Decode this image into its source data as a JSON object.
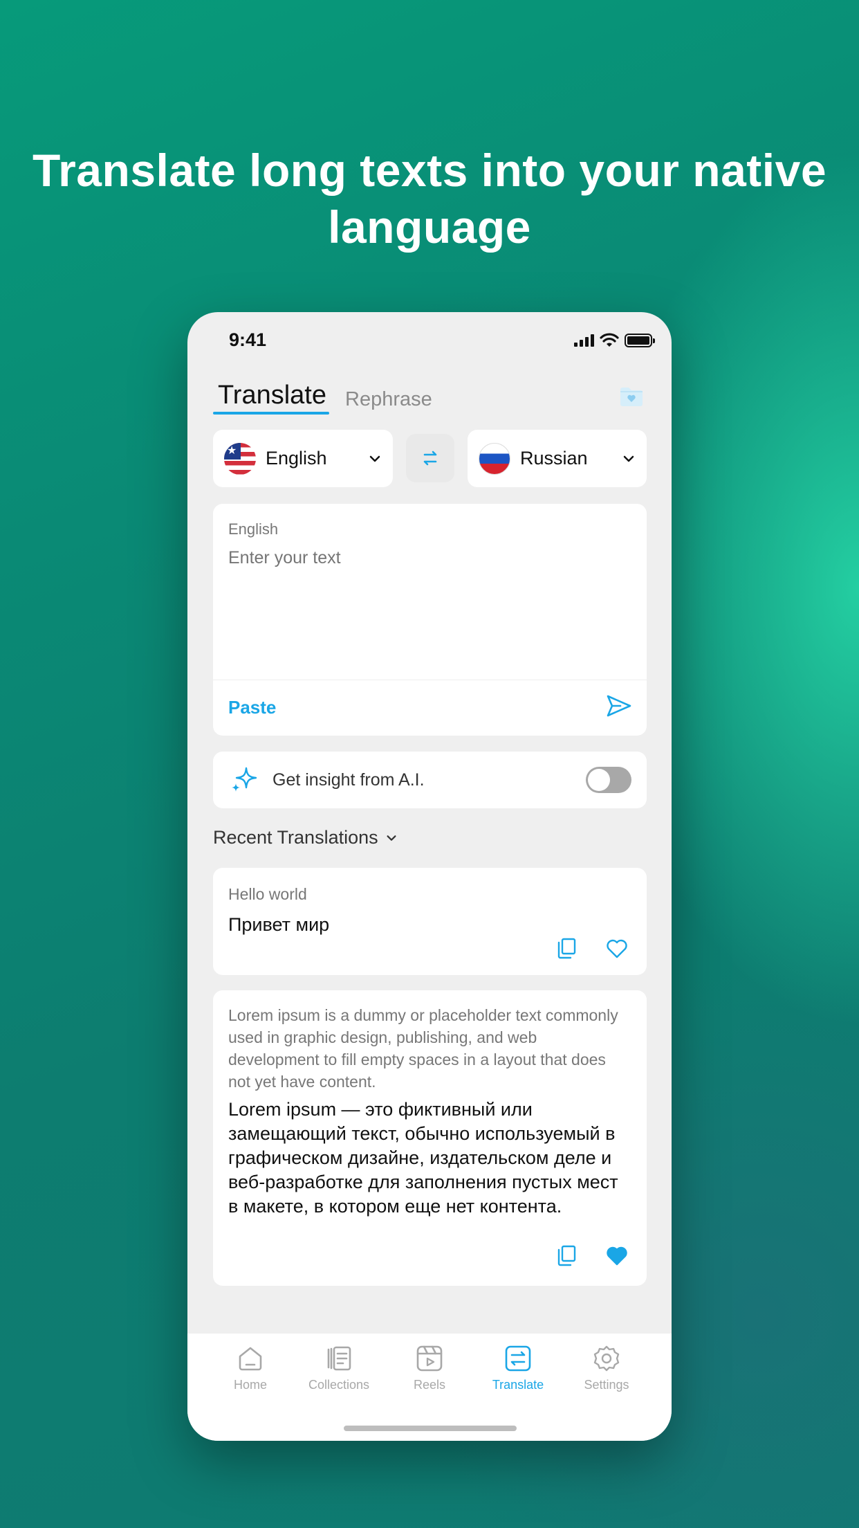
{
  "headline": "Translate long texts into your native language",
  "status_bar": {
    "time": "9:41"
  },
  "tabs": {
    "translate": "Translate",
    "rephrase": "Rephrase"
  },
  "languages": {
    "source": {
      "name": "English",
      "flag": "us-flag"
    },
    "target": {
      "name": "Russian",
      "flag": "russia-flag"
    }
  },
  "input": {
    "language_label": "English",
    "placeholder": "Enter your text",
    "paste_label": "Paste"
  },
  "ai_insight": {
    "label": "Get insight from A.I.",
    "enabled": false
  },
  "recent": {
    "header": "Recent Translations",
    "items": [
      {
        "source": "Hello world",
        "translation": "Привет мир",
        "favorite": false
      },
      {
        "source": "Lorem ipsum is a dummy or placeholder text commonly used in graphic design, publishing, and web development to fill empty spaces in a layout that does not yet have content.",
        "translation": "Lorem ipsum — это фиктивный или замещающий текст, обычно используемый в графическом дизайне, издательском деле и веб-разработке для заполнения пустых мест в макете, в котором еще нет контента.",
        "favorite": true
      }
    ]
  },
  "nav": {
    "items": [
      {
        "label": "Home",
        "icon": "home-icon"
      },
      {
        "label": "Collections",
        "icon": "collections-icon"
      },
      {
        "label": "Reels",
        "icon": "reels-icon"
      },
      {
        "label": "Translate",
        "icon": "translate-icon",
        "active": true
      },
      {
        "label": "Settings",
        "icon": "settings-icon"
      }
    ]
  },
  "colors": {
    "accent": "#1aa6e6",
    "background_start": "#079a7a",
    "background_glow": "#28dcaa"
  }
}
